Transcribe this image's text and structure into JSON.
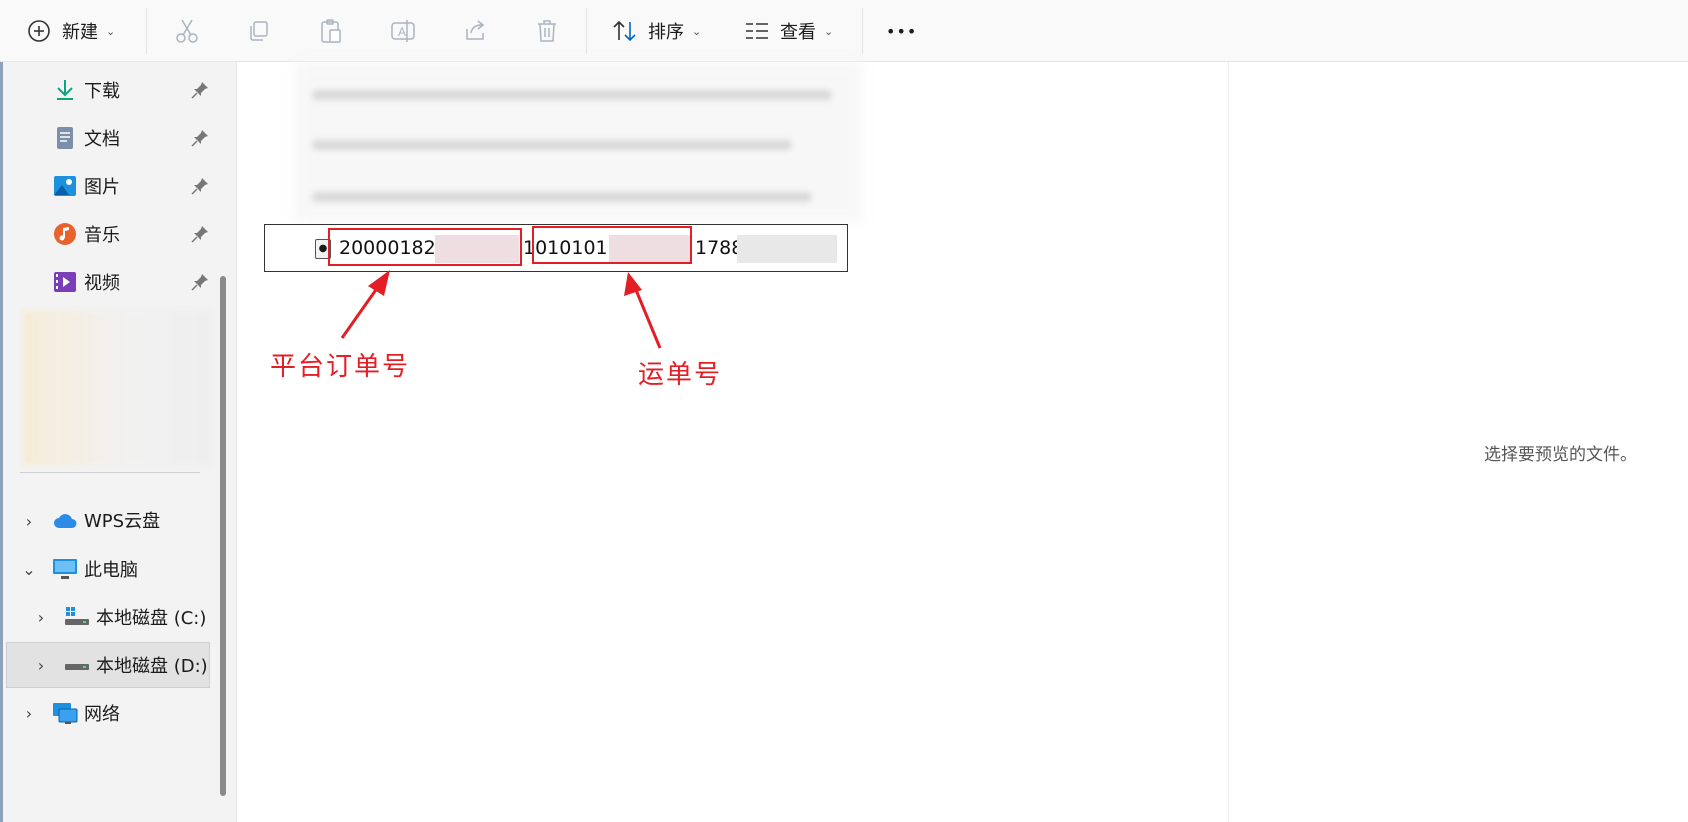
{
  "toolbar": {
    "new_label": "新建",
    "sort_label": "排序",
    "view_label": "查看",
    "more_label": "•••"
  },
  "sidebar": {
    "quick_access": [
      {
        "label": "下载",
        "icon": "download-icon"
      },
      {
        "label": "文档",
        "icon": "document-icon"
      },
      {
        "label": "图片",
        "icon": "pictures-icon"
      },
      {
        "label": "音乐",
        "icon": "music-icon"
      },
      {
        "label": "视频",
        "icon": "video-icon"
      }
    ],
    "tree": [
      {
        "label": "WPS云盘",
        "icon": "cloud-icon"
      },
      {
        "label": "此电脑",
        "icon": "computer-icon"
      },
      {
        "label": "本地磁盘 (C:)",
        "icon": "drive-c-icon"
      },
      {
        "label": "本地磁盘 (D:)",
        "icon": "drive-d-icon"
      },
      {
        "label": "网络",
        "icon": "network-icon"
      }
    ]
  },
  "file": {
    "part1": "200001825",
    "part2": "10101012",
    "part3": "1788"
  },
  "annotations": {
    "order_label": "平台订单号",
    "waybill_label": "运单号"
  },
  "preview": {
    "empty_text": "选择要预览的文件。"
  },
  "colors": {
    "annotation_red": "#e31e24",
    "accent_blue": "#0067c0"
  }
}
